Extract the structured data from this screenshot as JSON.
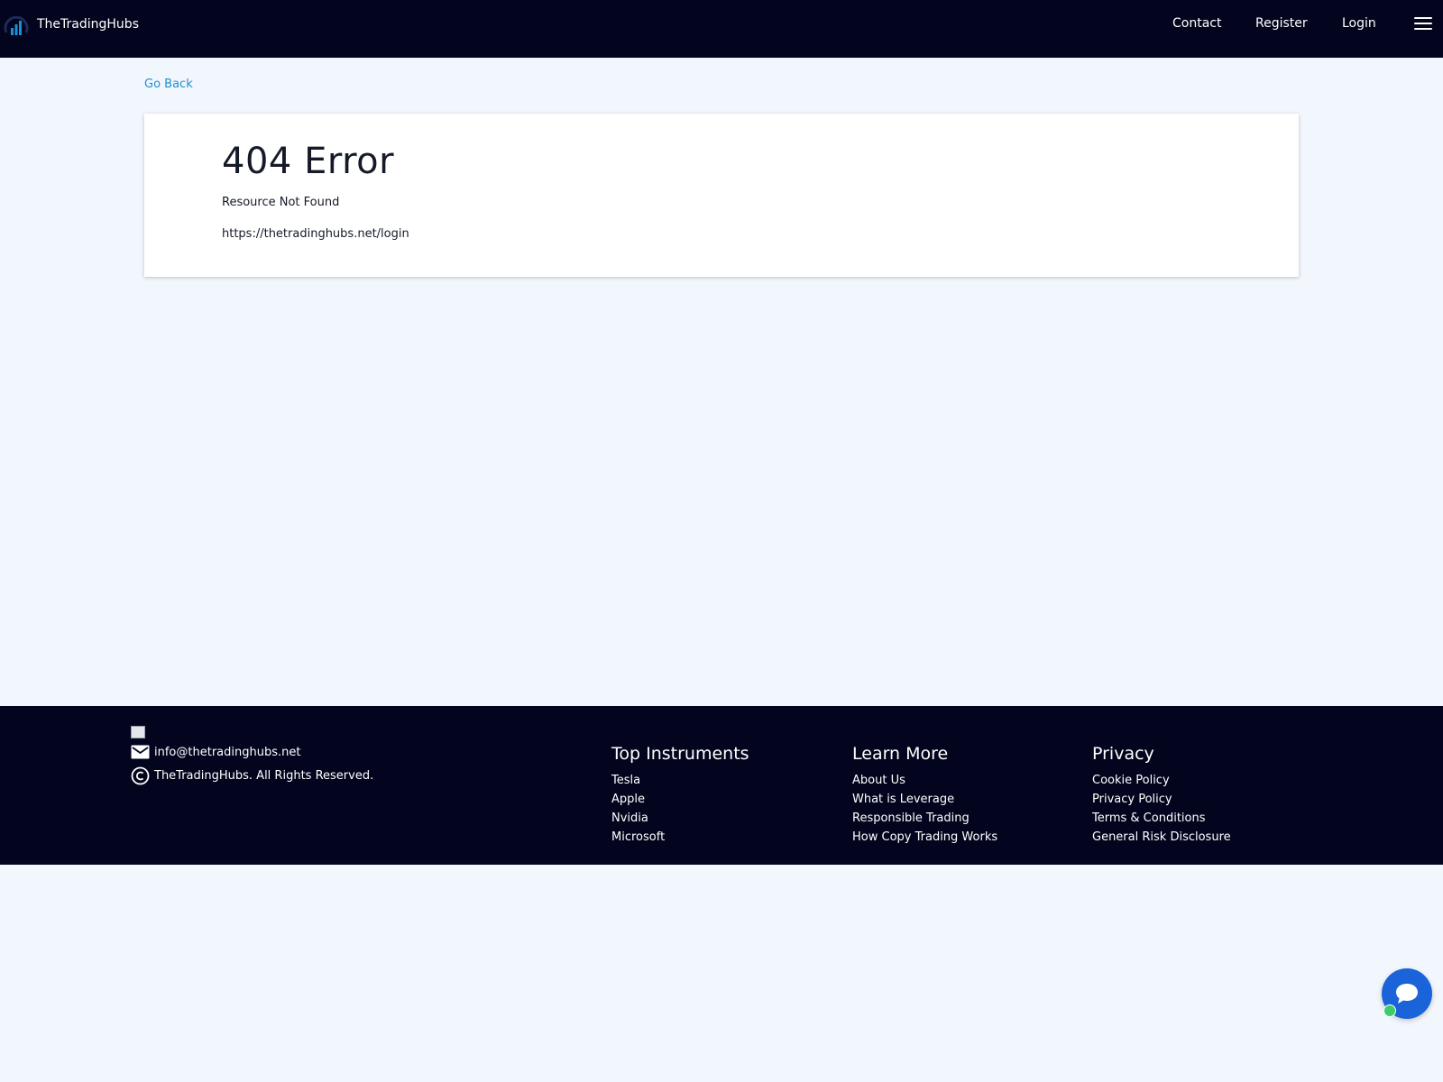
{
  "brand": {
    "name": "TheTradingHubs",
    "logo_icon": "bar-chart-logo-icon"
  },
  "nav": {
    "contact": "Contact",
    "register": "Register",
    "login": "Login",
    "menu_icon": "hamburger-menu-icon"
  },
  "main": {
    "go_back": "Go Back",
    "error_title": "404 Error",
    "error_subtitle": "Resource Not Found",
    "error_url": "https://thetradinghubs.net/login"
  },
  "footer": {
    "email": "info@thetradinghubs.net",
    "copyright": "TheTradingHubs. All Rights Reserved.",
    "columns": [
      {
        "heading": "Top Instruments",
        "links": [
          "Tesla",
          "Apple",
          "Nvidia",
          "Microsoft"
        ]
      },
      {
        "heading": "Learn More",
        "links": [
          "About Us",
          "What is Leverage",
          "Responsible Trading",
          "How Copy Trading Works"
        ]
      },
      {
        "heading": "Privacy",
        "links": [
          "Cookie Policy",
          "Privacy Policy",
          "Terms & Conditions",
          "General Risk Disclosure"
        ]
      }
    ]
  },
  "chat": {
    "icon": "chat-bubble-icon",
    "status": "online"
  },
  "colors": {
    "navbar_bg": "#03051e",
    "page_bg": "#f2f6fd",
    "link": "#1e8fd6",
    "chat_button": "#1a63d8",
    "online_dot": "#3ecb6a"
  }
}
